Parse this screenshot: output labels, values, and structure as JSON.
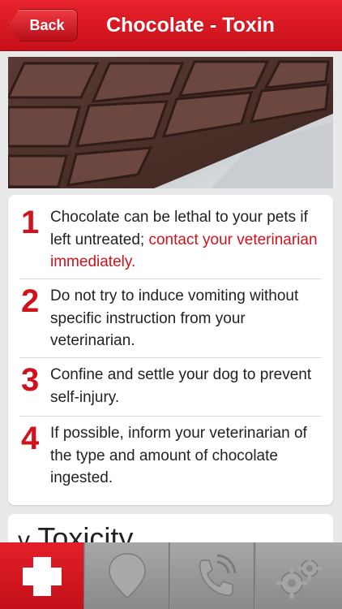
{
  "header": {
    "back_label": "Back",
    "title": "Chocolate - Toxin"
  },
  "steps": [
    {
      "num": "1",
      "text": "Chocolate can be lethal to your pets if left untreated; ",
      "highlight": "contact your veterinarian immediately."
    },
    {
      "num": "2",
      "text": "Do not try to induce vomiting without specific instruction from your veterinarian.",
      "highlight": ""
    },
    {
      "num": "3",
      "text": "Confine and settle your dog to prevent self-injury.",
      "highlight": ""
    },
    {
      "num": "4",
      "text": "If possible, inform your veterinarian of the type and amount of chocolate ingested.",
      "highlight": ""
    }
  ],
  "toxicity": {
    "label": "Toxicity",
    "chevron": "v"
  },
  "tabbar": {
    "tabs": [
      {
        "icon": "first-aid-cross-icon",
        "active": true
      },
      {
        "icon": "map-pin-icon",
        "active": false
      },
      {
        "icon": "phone-call-icon",
        "active": false
      },
      {
        "icon": "settings-gears-icon",
        "active": false
      }
    ]
  },
  "colors": {
    "accent": "#d0121c",
    "tab_inactive": "#9a9a9a"
  }
}
